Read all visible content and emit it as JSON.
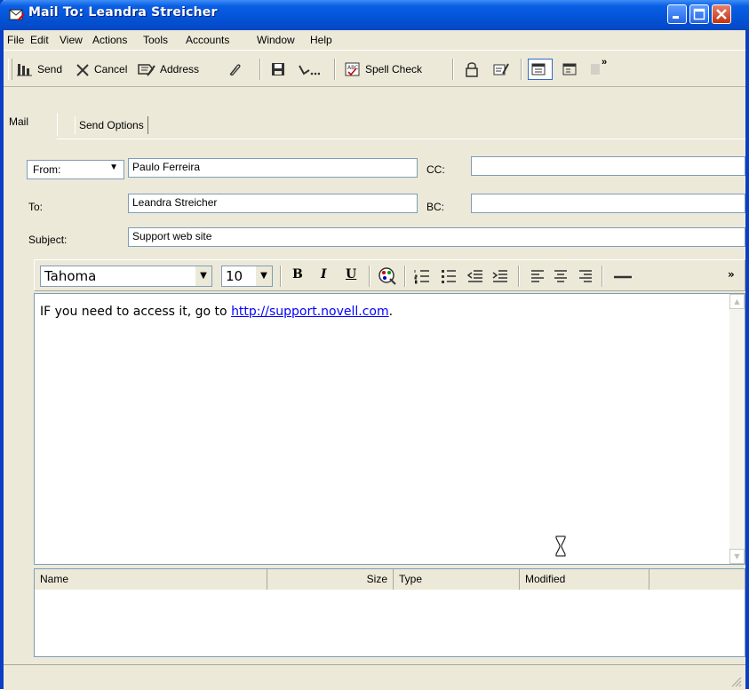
{
  "window": {
    "title": "Mail To: Leandra Streicher"
  },
  "menu": [
    "File",
    "Edit",
    "View",
    "Actions",
    "Tools",
    "Accounts",
    "Window",
    "Help"
  ],
  "toolbar": {
    "send": "Send",
    "cancel": "Cancel",
    "address": "Address",
    "spell_check": "Spell Check",
    "overflow": "»"
  },
  "tabs": {
    "mail": "Mail",
    "send_options": "Send Options"
  },
  "fields": {
    "from_label": "From:",
    "from_value": "Paulo Ferreira",
    "to_label": "To:",
    "to_value": "Leandra Streicher",
    "subject_label": "Subject:",
    "subject_value": "Support web site",
    "cc_label": "CC:",
    "cc_value": "",
    "bc_label": "BC:",
    "bc_value": ""
  },
  "format": {
    "font": "Tahoma",
    "size": "10",
    "bold": "B",
    "italic": "I",
    "underline": "U",
    "overflow": "»"
  },
  "body": {
    "text_before": "IF you need to access it, go to ",
    "link": "http://support.novell.com",
    "text_after": "."
  },
  "attachments": {
    "columns": [
      "Name",
      "Size",
      "Type",
      "Modified"
    ]
  }
}
